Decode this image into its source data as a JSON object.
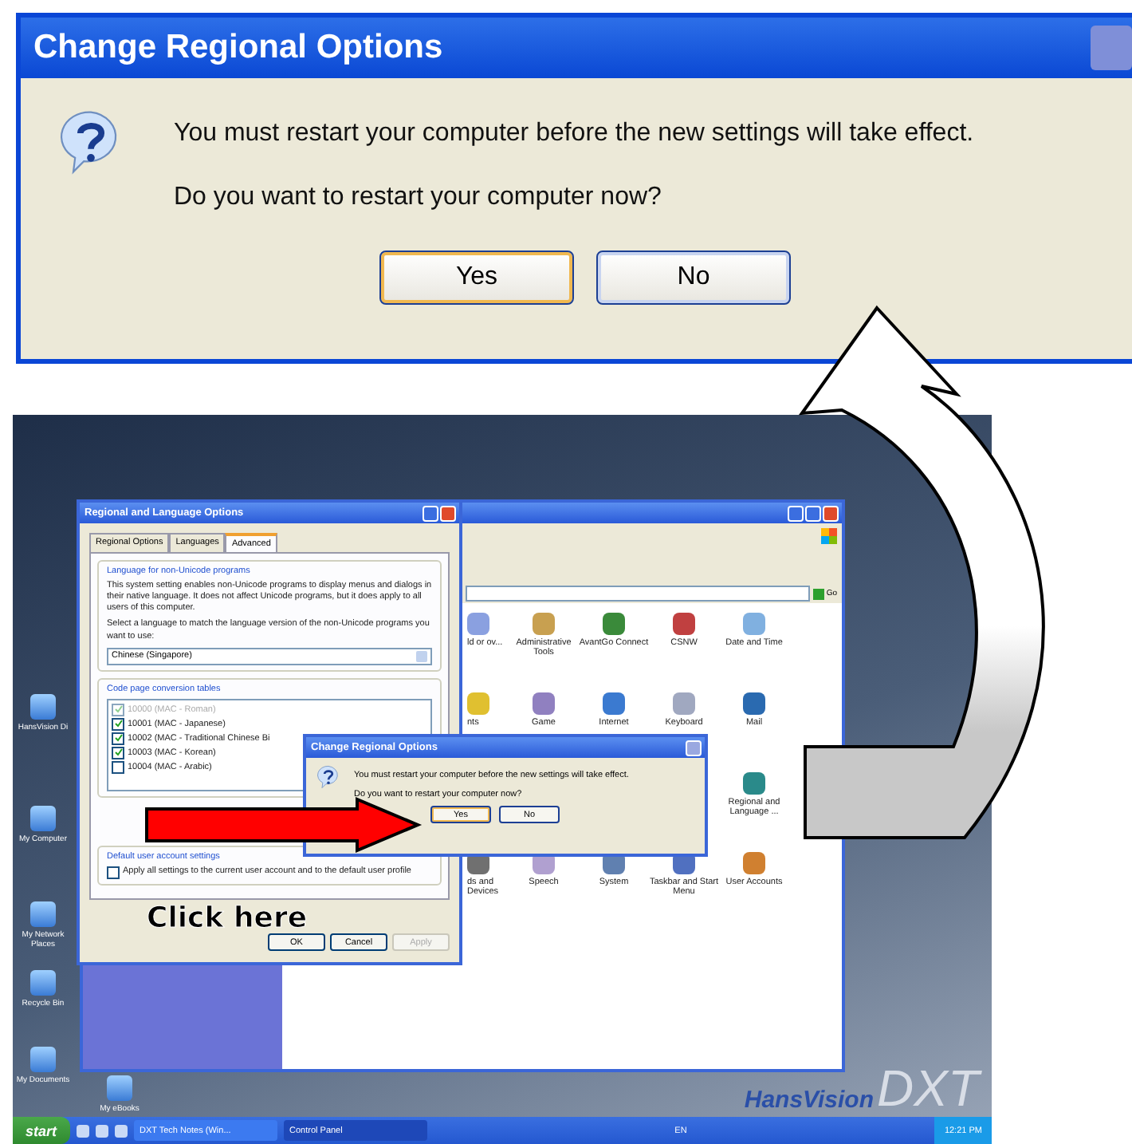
{
  "main_dialog": {
    "title": "Change Regional Options",
    "message": "You must restart your computer before the new settings will take effect.",
    "question": "Do you want to restart your computer now?",
    "buttons": [
      {
        "label": "Yes",
        "focused": true
      },
      {
        "label": "No",
        "focused": false
      }
    ]
  },
  "desktop": {
    "icons": [
      {
        "label": "HansVision Di"
      },
      {
        "label": "My Computer"
      },
      {
        "label": "My Network Places"
      },
      {
        "label": "Recycle Bin"
      },
      {
        "label": "My Documents"
      },
      {
        "label": "My eBooks"
      }
    ]
  },
  "regional_window": {
    "title": "Regional and Language Options",
    "tabs": [
      {
        "label": "Regional Options",
        "selected": false
      },
      {
        "label": "Languages",
        "selected": false
      },
      {
        "label": "Advanced",
        "selected": true
      }
    ],
    "language_group": {
      "title": "Language for non-Unicode programs",
      "description": "This system setting enables non-Unicode programs to display menus and dialogs in their native language. It does not affect Unicode programs, but it does apply to all users of this computer.",
      "prompt": "Select a language to match the language version of the non-Unicode programs you want to use:",
      "value": "Chinese (Singapore)"
    },
    "code_page_group": {
      "title": "Code page conversion tables",
      "items": [
        {
          "label": "10000 (MAC - Roman)",
          "checked": true,
          "disabled": true
        },
        {
          "label": "10001 (MAC - Japanese)",
          "checked": true,
          "disabled": false
        },
        {
          "label": "10002 (MAC - Traditional Chinese Bi",
          "checked": true,
          "disabled": false
        },
        {
          "label": "10003 (MAC - Korean)",
          "checked": true,
          "disabled": false
        },
        {
          "label": "10004 (MAC - Arabic)",
          "checked": false,
          "disabled": false
        }
      ]
    },
    "account_group": {
      "title": "Default user account settings",
      "option": {
        "label": "Apply all settings to the current user account and to the default user profile",
        "checked": false
      }
    },
    "buttons": [
      {
        "label": "OK",
        "disabled": false
      },
      {
        "label": "Cancel",
        "disabled": false
      },
      {
        "label": "Apply",
        "disabled": true
      }
    ]
  },
  "control_panel": {
    "address_button": "Go",
    "items": [
      {
        "label": "ld or ov..."
      },
      {
        "label": "Administrative Tools"
      },
      {
        "label": "AvantGo Connect"
      },
      {
        "label": "CSNW"
      },
      {
        "label": "Date and Time"
      },
      {
        "label": "nts"
      },
      {
        "label": "Game"
      },
      {
        "label": "Internet"
      },
      {
        "label": "Keyboard"
      },
      {
        "label": "Mail"
      },
      {
        "label": "Regional and Language ..."
      },
      {
        "label": "ds and Devices"
      },
      {
        "label": "Speech"
      },
      {
        "label": "System"
      },
      {
        "label": "Taskbar and Start Menu"
      },
      {
        "label": "User Accounts"
      }
    ]
  },
  "small_dialog": {
    "title": "Change Regional Options",
    "message": "You must restart your computer before the new settings will take effect.",
    "question": "Do you want to restart your computer now?",
    "buttons": [
      {
        "label": "Yes",
        "focused": true
      },
      {
        "label": "No",
        "focused": false
      }
    ]
  },
  "logo": {
    "brand": "HansVision",
    "mark": "DXT"
  },
  "taskbar": {
    "start": "start",
    "tasks": [
      {
        "label": "DXT Tech Notes (Win...",
        "selected": false
      },
      {
        "label": "Control Panel",
        "selected": true
      }
    ],
    "language": "EN",
    "clock": "12:21 PM"
  },
  "annotation": {
    "label": "Click here"
  }
}
